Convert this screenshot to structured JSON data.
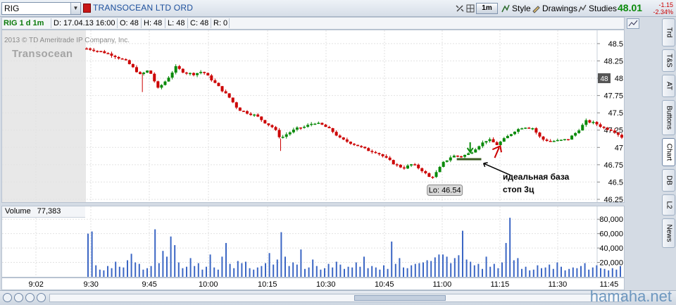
{
  "toolbar": {
    "symbol": "RIG",
    "company": "TRANSOCEAN LTD ORD",
    "timeframe": "1m",
    "style_label": "Style",
    "drawings_label": "Drawings",
    "studies_label": "Studies",
    "last_price": "48.01",
    "change": "-1.15",
    "change_pct": "-2.34%",
    "colors": {
      "up": "#0a8a0a",
      "down": "#cc0000",
      "link": "#1c4f9c"
    }
  },
  "infobar": {
    "symbol_tag": "RIG 1 d 1m",
    "date": "D: 17.04.13 16:00",
    "open": "O: 48",
    "high": "H: 48",
    "low": "L: 48",
    "close": "C: 48",
    "range": "R: 0"
  },
  "watermarks": {
    "copyright": "2013 © TD Ameritrade IP Company, Inc.",
    "logo": "Transocean",
    "site": "hamaha.net"
  },
  "annotations": {
    "low_label": "Lo: 46.54",
    "note_line1": "идеальная база",
    "note_line2": "стоп 3ц",
    "current_price_tag": "48"
  },
  "volume": {
    "label": "Volume",
    "value": "77,383"
  },
  "right_tabs": [
    "Trd",
    "T&S",
    "AT",
    "Buttons",
    "Chart",
    "DB",
    "L2",
    "News"
  ],
  "active_tab": "Chart",
  "chart_data": [
    {
      "type": "candlestick",
      "title": "RIG 1 d 1m",
      "y_ticks": [
        "48.5",
        "48.25",
        "48",
        "47.75",
        "47.5",
        "47.25",
        "47",
        "46.75",
        "46.5",
        "46.25"
      ],
      "ylim": [
        46.25,
        48.55
      ],
      "x_ticks": [
        "9:02",
        "9:30",
        "9:45",
        "10:00",
        "10:15",
        "10:30",
        "10:45",
        "11:00",
        "11:15",
        "11:30",
        "11:45"
      ],
      "close_path": [
        {
          "t": 0,
          "price": 48.43
        },
        {
          "t": 7,
          "price": 48.38
        },
        {
          "t": 12,
          "price": 48.33
        },
        {
          "t": 18,
          "price": 48.24
        },
        {
          "t": 24,
          "price": 48.05
        },
        {
          "t": 28,
          "price": 48.12
        },
        {
          "t": 32,
          "price": 47.85
        },
        {
          "t": 36,
          "price": 47.98
        },
        {
          "t": 40,
          "price": 48.16
        },
        {
          "t": 44,
          "price": 48.08
        },
        {
          "t": 48,
          "price": 48.06
        },
        {
          "t": 52,
          "price": 48.1
        },
        {
          "t": 56,
          "price": 47.98
        },
        {
          "t": 60,
          "price": 47.85
        },
        {
          "t": 64,
          "price": 47.72
        },
        {
          "t": 68,
          "price": 47.55
        },
        {
          "t": 72,
          "price": 47.5
        },
        {
          "t": 76,
          "price": 47.46
        },
        {
          "t": 80,
          "price": 47.36
        },
        {
          "t": 84,
          "price": 47.28
        },
        {
          "t": 87,
          "price": 47.13
        },
        {
          "t": 90,
          "price": 47.2
        },
        {
          "t": 94,
          "price": 47.27
        },
        {
          "t": 98,
          "price": 47.3
        },
        {
          "t": 102,
          "price": 47.36
        },
        {
          "t": 106,
          "price": 47.32
        },
        {
          "t": 110,
          "price": 47.24
        },
        {
          "t": 114,
          "price": 47.12
        },
        {
          "t": 118,
          "price": 47.07
        },
        {
          "t": 122,
          "price": 47.02
        },
        {
          "t": 126,
          "price": 46.96
        },
        {
          "t": 130,
          "price": 46.93
        },
        {
          "t": 134,
          "price": 46.85
        },
        {
          "t": 138,
          "price": 46.76
        },
        {
          "t": 142,
          "price": 46.7
        },
        {
          "t": 146,
          "price": 46.76
        },
        {
          "t": 150,
          "price": 46.68
        },
        {
          "t": 154,
          "price": 46.56
        },
        {
          "t": 156,
          "price": 46.6
        },
        {
          "t": 160,
          "price": 46.78
        },
        {
          "t": 164,
          "price": 46.88
        },
        {
          "t": 168,
          "price": 46.87
        },
        {
          "t": 172,
          "price": 46.92
        },
        {
          "t": 176,
          "price": 47.03
        },
        {
          "t": 180,
          "price": 47.12
        },
        {
          "t": 184,
          "price": 47.04
        },
        {
          "t": 188,
          "price": 47.14
        },
        {
          "t": 192,
          "price": 47.24
        },
        {
          "t": 196,
          "price": 47.3
        },
        {
          "t": 200,
          "price": 47.28
        },
        {
          "t": 204,
          "price": 47.12
        },
        {
          "t": 208,
          "price": 47.09
        },
        {
          "t": 212,
          "price": 47.1
        },
        {
          "t": 216,
          "price": 47.12
        },
        {
          "t": 220,
          "price": 47.23
        },
        {
          "t": 224,
          "price": 47.38
        },
        {
          "t": 228,
          "price": 47.35
        },
        {
          "t": 232,
          "price": 47.28
        },
        {
          "t": 236,
          "price": 47.25
        },
        {
          "t": 240,
          "price": 47.15
        }
      ],
      "low": 46.54,
      "base_level": 46.83
    },
    {
      "type": "bar",
      "title": "Volume",
      "y_ticks": [
        "80,000",
        "60,000",
        "40,000",
        "20,000"
      ],
      "ylim": [
        0,
        90000
      ],
      "x_ticks": [
        "9:02",
        "9:30",
        "9:45",
        "10:00",
        "10:15",
        "10:30",
        "10:45",
        "11:00",
        "11:15",
        "11:30",
        "11:45"
      ],
      "values": [
        60000,
        63000,
        16000,
        10000,
        9000,
        15000,
        12000,
        21000,
        14000,
        13000,
        23000,
        32000,
        20000,
        18000,
        10000,
        12000,
        15000,
        66000,
        19000,
        36000,
        28000,
        56000,
        44000,
        20000,
        12000,
        14000,
        26000,
        15000,
        19000,
        10000,
        14000,
        31000,
        13000,
        10000,
        28000,
        47000,
        18000,
        12000,
        22000,
        19000,
        21000,
        12000,
        10000,
        13000,
        15000,
        19000,
        33000,
        17000,
        24000,
        62000,
        28000,
        15000,
        20000,
        17000,
        38000,
        11000,
        13000,
        24000,
        15000,
        10000,
        12000,
        18000,
        13000,
        21000,
        17000,
        11000,
        14000,
        13000,
        20000,
        14000,
        28000,
        12000,
        15000,
        13000,
        10000,
        16000,
        11000,
        49000,
        18000,
        26000,
        13000,
        12000,
        16000,
        18000,
        19000,
        20000,
        23000,
        22000,
        27000,
        31000,
        31000,
        28000,
        19000,
        26000,
        30000,
        64000,
        24000,
        21000,
        16000,
        18000,
        11000,
        28000,
        14000,
        18000,
        12000,
        20000,
        47000,
        82000,
        23000,
        26000,
        11000,
        14000,
        9000,
        10000,
        16000,
        12000,
        13000,
        17000,
        11000,
        20000,
        14000,
        9000,
        11000,
        13000,
        12000,
        15000,
        19000,
        10000,
        13000,
        16000,
        12000,
        11000,
        9000,
        12000,
        10000,
        15000
      ]
    }
  ]
}
